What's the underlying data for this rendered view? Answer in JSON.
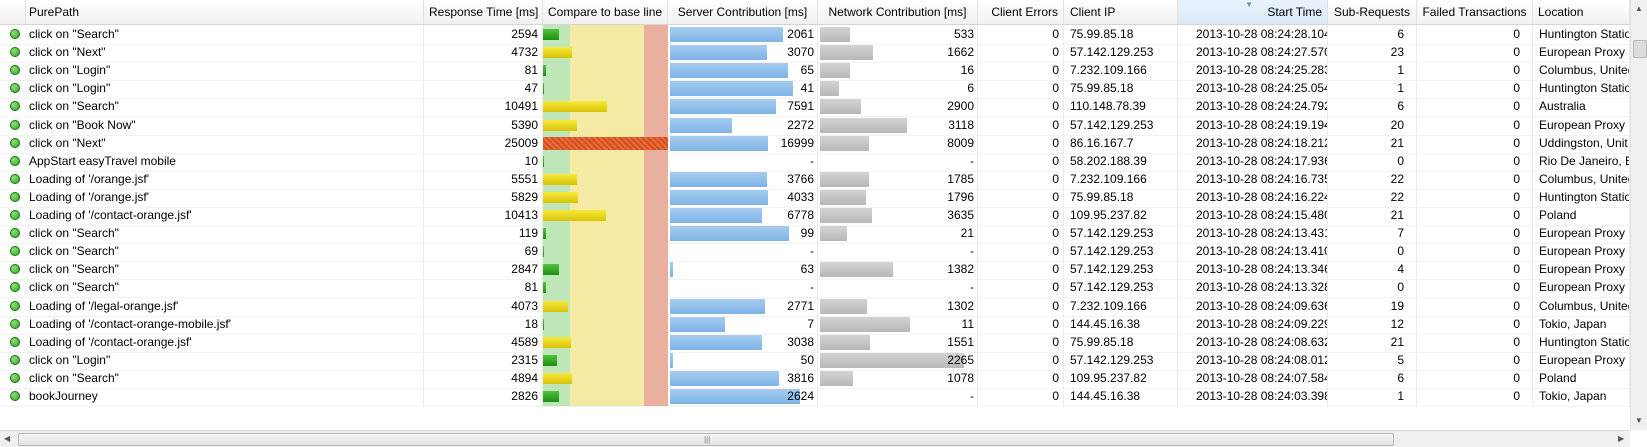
{
  "columns": {
    "purepath": "PurePath",
    "response_time": "Response Time [ms]",
    "compare": "Compare to base line",
    "server": "Server Contribution [ms]",
    "network": "Network Contribution [ms]",
    "client_errors": "Client Errors",
    "client_ip": "Client IP",
    "start_time": "Start Time",
    "sub_requests": "Sub-Requests",
    "failed": "Failed Transactions",
    "location": "Location"
  },
  "sort_indicator": "▼",
  "colors": {
    "status_ok": "#2a9a1e",
    "bar_green": "#1f8f12",
    "bar_yellow": "#d9c20a",
    "bar_red": "#d45021",
    "server_bar": "#7fb3e6",
    "network_bar": "#b8b8b8"
  },
  "rows": [
    {
      "purepath": "click on \"Search\"",
      "response_time": "2594",
      "compare": "green",
      "compare_fill": 0.13,
      "server": "2061",
      "server_fill": 0.81,
      "network": "533",
      "network_fill": 0.2,
      "client_errors": "0",
      "client_ip": "75.99.85.18",
      "start_time": "2013-10-28 08:24:28.104",
      "sub_requests": "6",
      "failed": "0",
      "location": "Huntington Statio"
    },
    {
      "purepath": "click on \"Next\"",
      "response_time": "4732",
      "compare": "yellow",
      "compare_fill": 0.23,
      "server": "3070",
      "server_fill": 0.69,
      "network": "1662",
      "network_fill": 0.36,
      "client_errors": "0",
      "client_ip": "57.142.129.253",
      "start_time": "2013-10-28 08:24:27.570",
      "sub_requests": "23",
      "failed": "0",
      "location": "European Proxy"
    },
    {
      "purepath": "click on \"Login\"",
      "response_time": "81",
      "compare": "green",
      "compare_fill": 0.02,
      "server": "65",
      "server_fill": 0.84,
      "network": "16",
      "network_fill": 0.2,
      "client_errors": "0",
      "client_ip": "7.232.109.166",
      "start_time": "2013-10-28 08:24:25.283",
      "sub_requests": "1",
      "failed": "0",
      "location": "Columbus, United"
    },
    {
      "purepath": "click on \"Login\"",
      "response_time": "47",
      "compare": "green",
      "compare_fill": 0.01,
      "server": "41",
      "server_fill": 0.88,
      "network": "6",
      "network_fill": 0.13,
      "client_errors": "0",
      "client_ip": "75.99.85.18",
      "start_time": "2013-10-28 08:24:25.054",
      "sub_requests": "1",
      "failed": "0",
      "location": "Huntington Statio"
    },
    {
      "purepath": "click on \"Search\"",
      "response_time": "10491",
      "compare": "yellow",
      "compare_fill": 0.51,
      "server": "7591",
      "server_fill": 0.76,
      "network": "2900",
      "network_fill": 0.28,
      "client_errors": "0",
      "client_ip": "110.148.78.39",
      "start_time": "2013-10-28 08:24:24.792",
      "sub_requests": "6",
      "failed": "0",
      "location": "Australia"
    },
    {
      "purepath": "click on \"Book Now\"",
      "response_time": "5390",
      "compare": "yellow",
      "compare_fill": 0.27,
      "server": "2272",
      "server_fill": 0.44,
      "network": "3118",
      "network_fill": 0.59,
      "client_errors": "0",
      "client_ip": "57.142.129.253",
      "start_time": "2013-10-28 08:24:19.194",
      "sub_requests": "20",
      "failed": "0",
      "location": "European Proxy"
    },
    {
      "purepath": "click on \"Next\"",
      "response_time": "25009",
      "compare": "red",
      "compare_fill": 1.0,
      "server": "16999",
      "server_fill": 0.7,
      "network": "8009",
      "network_fill": 0.33,
      "client_errors": "0",
      "client_ip": "86.16.167.7",
      "start_time": "2013-10-28 08:24:18.212",
      "sub_requests": "21",
      "failed": "0",
      "location": "Uddingston, Unit"
    },
    {
      "purepath": "AppStart easyTravel mobile",
      "response_time": "10",
      "compare": "green",
      "compare_fill": 0.01,
      "server": "-",
      "server_fill": 0,
      "network": "-",
      "network_fill": 0,
      "client_errors": "0",
      "client_ip": "58.202.188.39",
      "start_time": "2013-10-28 08:24:17.936",
      "sub_requests": "0",
      "failed": "0",
      "location": "Rio De Janeiro, Bra"
    },
    {
      "purepath": "Loading of '/orange.jsf'",
      "response_time": "5551",
      "compare": "yellow",
      "compare_fill": 0.27,
      "server": "3766",
      "server_fill": 0.69,
      "network": "1785",
      "network_fill": 0.33,
      "client_errors": "0",
      "client_ip": "7.232.109.166",
      "start_time": "2013-10-28 08:24:16.735",
      "sub_requests": "22",
      "failed": "0",
      "location": "Columbus, United"
    },
    {
      "purepath": "Loading of '/orange.jsf'",
      "response_time": "5829",
      "compare": "yellow",
      "compare_fill": 0.28,
      "server": "4033",
      "server_fill": 0.7,
      "network": "1796",
      "network_fill": 0.31,
      "client_errors": "0",
      "client_ip": "75.99.85.18",
      "start_time": "2013-10-28 08:24:16.224",
      "sub_requests": "22",
      "failed": "0",
      "location": "Huntington Statio"
    },
    {
      "purepath": "Loading of '/contact-orange.jsf'",
      "response_time": "10413",
      "compare": "yellow",
      "compare_fill": 0.5,
      "server": "6778",
      "server_fill": 0.66,
      "network": "3635",
      "network_fill": 0.35,
      "client_errors": "0",
      "client_ip": "109.95.237.82",
      "start_time": "2013-10-28 08:24:15.480",
      "sub_requests": "21",
      "failed": "0",
      "location": "Poland"
    },
    {
      "purepath": "click on \"Search\"",
      "response_time": "119",
      "compare": "green",
      "compare_fill": 0.02,
      "server": "99",
      "server_fill": 0.85,
      "network": "21",
      "network_fill": 0.18,
      "client_errors": "0",
      "client_ip": "57.142.129.253",
      "start_time": "2013-10-28 08:24:13.431",
      "sub_requests": "7",
      "failed": "0",
      "location": "European Proxy"
    },
    {
      "purepath": "click on \"Search\"",
      "response_time": "69",
      "compare": "green",
      "compare_fill": 0.01,
      "server": "-",
      "server_fill": 0,
      "network": "-",
      "network_fill": 0,
      "client_errors": "0",
      "client_ip": "57.142.129.253",
      "start_time": "2013-10-28 08:24:13.410",
      "sub_requests": "0",
      "failed": "0",
      "location": "European Proxy"
    },
    {
      "purepath": "click on \"Search\"",
      "response_time": "2847",
      "compare": "green",
      "compare_fill": 0.13,
      "server": "63",
      "server_fill": 0.02,
      "network": "1382",
      "network_fill": 0.49,
      "client_errors": "0",
      "client_ip": "57.142.129.253",
      "start_time": "2013-10-28 08:24:13.346",
      "sub_requests": "4",
      "failed": "0",
      "location": "European Proxy"
    },
    {
      "purepath": "click on \"Search\"",
      "response_time": "81",
      "compare": "green",
      "compare_fill": 0.02,
      "server": "-",
      "server_fill": 0,
      "network": "-",
      "network_fill": 0,
      "client_errors": "0",
      "client_ip": "57.142.129.253",
      "start_time": "2013-10-28 08:24:13.328",
      "sub_requests": "0",
      "failed": "0",
      "location": "European Proxy"
    },
    {
      "purepath": "Loading of '/legal-orange.jsf'",
      "response_time": "4073",
      "compare": "yellow",
      "compare_fill": 0.2,
      "server": "2771",
      "server_fill": 0.68,
      "network": "1302",
      "network_fill": 0.32,
      "client_errors": "0",
      "client_ip": "7.232.109.166",
      "start_time": "2013-10-28 08:24:09.636",
      "sub_requests": "19",
      "failed": "0",
      "location": "Columbus, United"
    },
    {
      "purepath": "Loading of '/contact-orange-mobile.jsf'",
      "response_time": "18",
      "compare": "green",
      "compare_fill": 0.01,
      "server": "7",
      "server_fill": 0.39,
      "network": "11",
      "network_fill": 0.61,
      "client_errors": "0",
      "client_ip": "144.45.16.38",
      "start_time": "2013-10-28 08:24:09.229",
      "sub_requests": "12",
      "failed": "0",
      "location": "Tokio, Japan"
    },
    {
      "purepath": "Loading of '/contact-orange.jsf'",
      "response_time": "4589",
      "compare": "yellow",
      "compare_fill": 0.22,
      "server": "3038",
      "server_fill": 0.66,
      "network": "1551",
      "network_fill": 0.34,
      "client_errors": "0",
      "client_ip": "75.99.85.18",
      "start_time": "2013-10-28 08:24:08.632",
      "sub_requests": "21",
      "failed": "0",
      "location": "Huntington Statio"
    },
    {
      "purepath": "click on \"Login\"",
      "response_time": "2315",
      "compare": "green",
      "compare_fill": 0.11,
      "server": "50",
      "server_fill": 0.02,
      "network": "2265",
      "network_fill": 0.97,
      "client_errors": "0",
      "client_ip": "57.142.129.253",
      "start_time": "2013-10-28 08:24:08.012",
      "sub_requests": "5",
      "failed": "0",
      "location": "European Proxy"
    },
    {
      "purepath": "click on \"Search\"",
      "response_time": "4894",
      "compare": "yellow",
      "compare_fill": 0.23,
      "server": "3816",
      "server_fill": 0.78,
      "network": "1078",
      "network_fill": 0.22,
      "client_errors": "0",
      "client_ip": "109.95.237.82",
      "start_time": "2013-10-28 08:24:07.584",
      "sub_requests": "6",
      "failed": "0",
      "location": "Poland"
    },
    {
      "purepath": "bookJourney",
      "response_time": "2826",
      "compare": "green",
      "compare_fill": 0.13,
      "server": "2624",
      "server_fill": 0.93,
      "network": "-",
      "network_fill": 0,
      "client_errors": "0",
      "client_ip": "144.45.16.38",
      "start_time": "2013-10-28 08:24:03.398",
      "sub_requests": "1",
      "failed": "0",
      "location": "Tokio, Japan"
    }
  ]
}
